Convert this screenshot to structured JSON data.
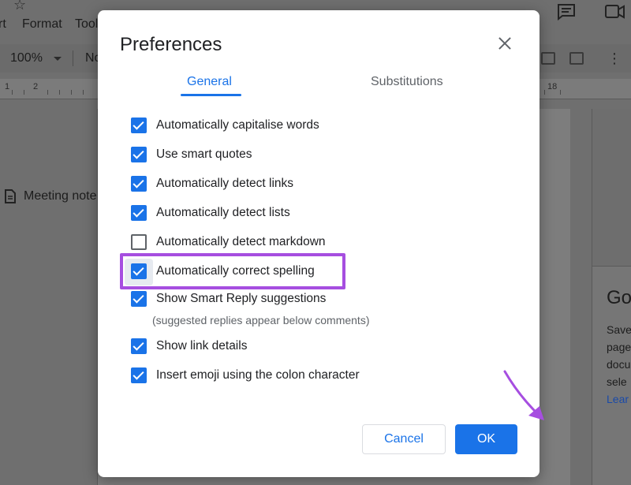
{
  "app": {
    "menu": [
      "rt",
      "Format",
      "Tool"
    ],
    "zoom": "100%",
    "style_partial": "No",
    "ruler_numbers": [
      "1",
      "2",
      "18"
    ],
    "outline_item": "Meeting note",
    "side_panel": {
      "heading": "Go",
      "lines": [
        "Save",
        "page",
        "docu",
        "sele"
      ],
      "link": "Lear"
    }
  },
  "dialog": {
    "title": "Preferences",
    "tabs": [
      {
        "label": "General",
        "active": true
      },
      {
        "label": "Substitutions",
        "active": false
      }
    ],
    "options": [
      {
        "label": "Automatically capitalise words",
        "checked": true
      },
      {
        "label": "Use smart quotes",
        "checked": true
      },
      {
        "label": "Automatically detect links",
        "checked": true
      },
      {
        "label": "Automatically detect lists",
        "checked": true
      },
      {
        "label": "Automatically detect markdown",
        "checked": false
      },
      {
        "label": "Automatically correct spelling",
        "checked": true
      },
      {
        "label": "Show Smart Reply suggestions",
        "checked": true
      },
      {
        "label": "Show link details",
        "checked": true
      },
      {
        "label": "Insert emoji using the colon character",
        "checked": true
      }
    ],
    "smart_reply_sub": "(suggested replies appear below comments)",
    "cancel_label": "Cancel",
    "ok_label": "OK"
  },
  "colors": {
    "accent": "#1a73e8",
    "highlight": "#a64ee0"
  }
}
